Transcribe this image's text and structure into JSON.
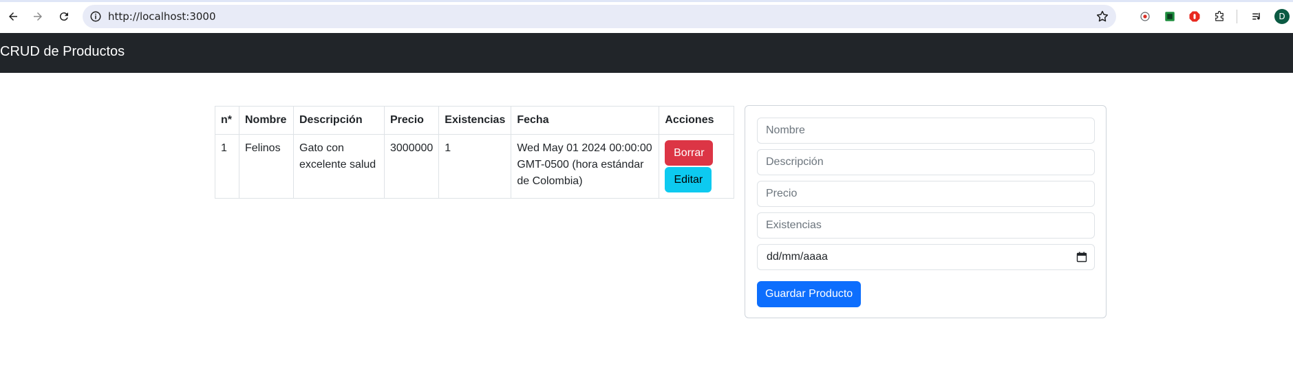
{
  "browser": {
    "url": "http://localhost:3000",
    "avatar_letter": "D"
  },
  "navbar": {
    "brand": "CRUD de Productos"
  },
  "table": {
    "headers": [
      "n*",
      "Nombre",
      "Descripción",
      "Precio",
      "Existencias",
      "Fecha",
      "Acciones"
    ],
    "rows": [
      {
        "n": "1",
        "nombre": "Felinos",
        "descripcion": "Gato con excelente salud",
        "precio": "3000000",
        "existencias": "1",
        "fecha": "Wed May 01 2024 00:00:00 GMT-0500 (hora estándar de Colombia)",
        "delete_label": "Borrar",
        "edit_label": "Editar"
      }
    ]
  },
  "form": {
    "nombre_placeholder": "Nombre",
    "descripcion_placeholder": "Descripción",
    "precio_placeholder": "Precio",
    "existencias_placeholder": "Existencias",
    "fecha_value": "dd/mm/aaaa",
    "submit_label": "Guardar Producto"
  },
  "colors": {
    "navbar": "#212529",
    "danger": "#dc3545",
    "info": "#0dcaf0",
    "primary": "#0d6efd"
  }
}
